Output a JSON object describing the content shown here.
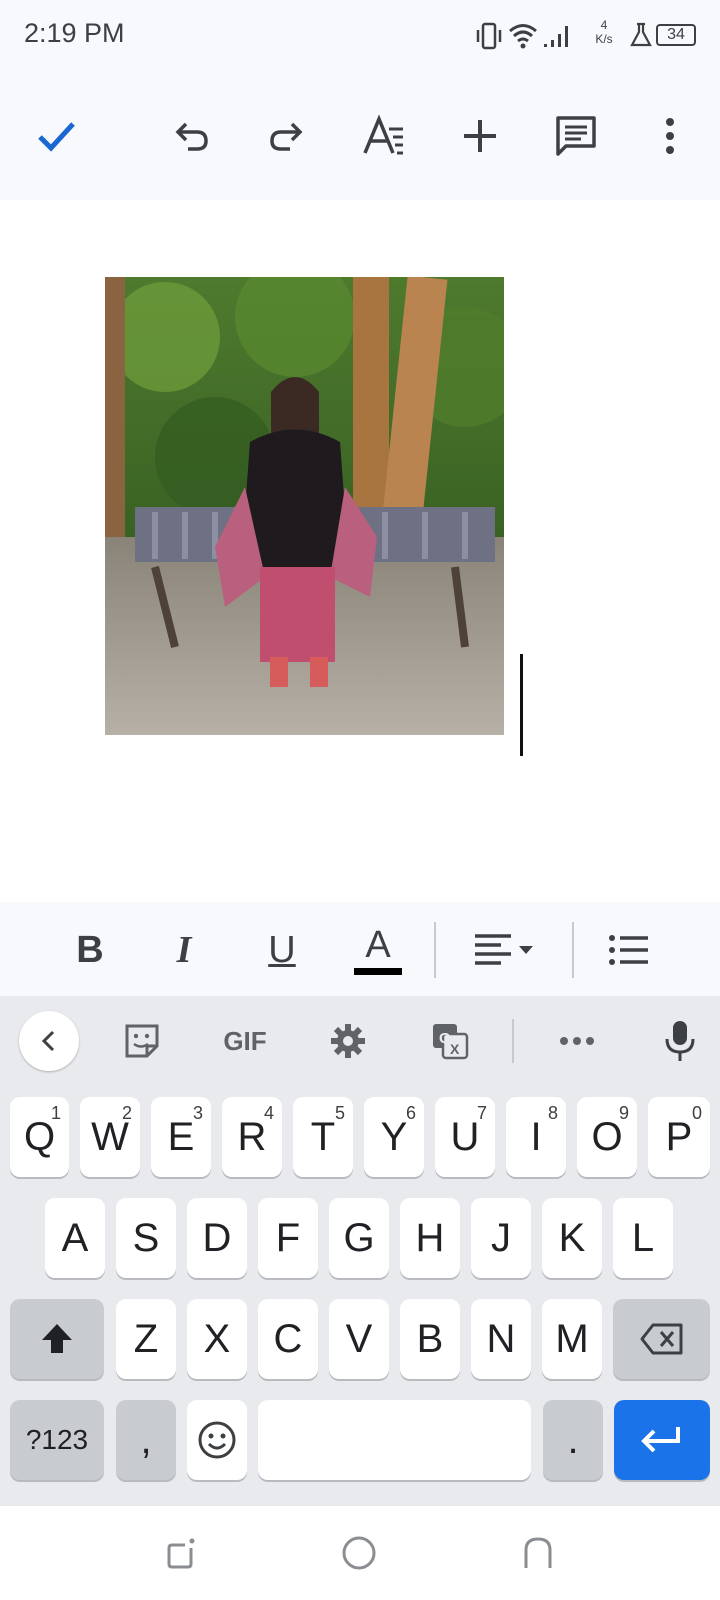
{
  "status_bar": {
    "time": "2:19 PM",
    "net_speed_value": "4",
    "net_speed_unit": "K/s",
    "battery": "34",
    "icons": [
      "vibrate-icon",
      "wifi-icon",
      "signal-icon",
      "lab-flask-icon",
      "battery-icon"
    ]
  },
  "toolbar": {
    "icons": [
      "check-icon",
      "undo-icon",
      "redo-icon",
      "text-format-icon",
      "add-icon",
      "comment-icon",
      "more-vert-icon"
    ],
    "accent": "#1967d2"
  },
  "document": {
    "image_description_icon": "photo-image"
  },
  "format_bar": {
    "bold": "B",
    "italic": "I",
    "underline": "U",
    "text_color": "A",
    "text_color_swatch": "#000000",
    "icons": [
      "align-left-icon",
      "bullet-list-icon"
    ]
  },
  "keyboard_toolbar": {
    "gif_label": "GIF",
    "icons": [
      "back-chevron-icon",
      "sticker-icon",
      "settings-icon",
      "translate-icon",
      "more-horiz-icon",
      "mic-icon"
    ]
  },
  "keyboard": {
    "row1": [
      {
        "label": "Q",
        "hint": "1"
      },
      {
        "label": "W",
        "hint": "2"
      },
      {
        "label": "E",
        "hint": "3"
      },
      {
        "label": "R",
        "hint": "4"
      },
      {
        "label": "T",
        "hint": "5"
      },
      {
        "label": "Y",
        "hint": "6"
      },
      {
        "label": "U",
        "hint": "7"
      },
      {
        "label": "I",
        "hint": "8"
      },
      {
        "label": "O",
        "hint": "9"
      },
      {
        "label": "P",
        "hint": "0"
      }
    ],
    "row2": [
      "A",
      "S",
      "D",
      "F",
      "G",
      "H",
      "J",
      "K",
      "L"
    ],
    "row3": [
      "Z",
      "X",
      "C",
      "V",
      "B",
      "N",
      "M"
    ],
    "symbols_label": "?123",
    "comma_label": ",",
    "period_label": ".",
    "enter_color": "#1a73e8"
  },
  "nav_bar": {
    "icons": [
      "recents-icon",
      "home-icon",
      "back-icon"
    ]
  }
}
